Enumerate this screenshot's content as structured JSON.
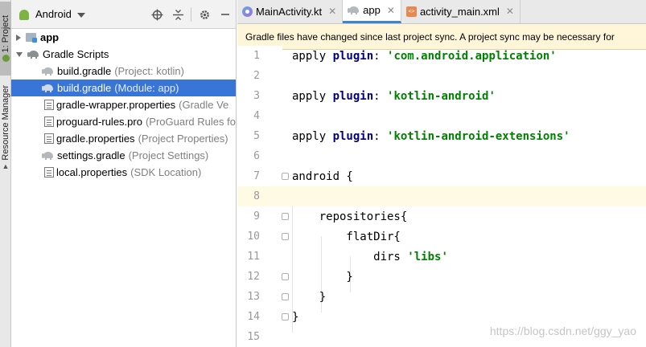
{
  "side_strip": {
    "tabs": [
      {
        "label": "1: Project"
      },
      {
        "label": "Resource Manager"
      }
    ]
  },
  "project_panel": {
    "view_selector": "Android",
    "tree": [
      {
        "label": "app",
        "hint": ""
      },
      {
        "label": "Gradle Scripts",
        "hint": ""
      },
      {
        "label": "build.gradle",
        "hint": "(Project: kotlin)"
      },
      {
        "label": "build.gradle",
        "hint": "(Module: app)"
      },
      {
        "label": "gradle-wrapper.properties",
        "hint": "(Gradle Ve"
      },
      {
        "label": "proguard-rules.pro",
        "hint": "(ProGuard Rules fo"
      },
      {
        "label": "gradle.properties",
        "hint": "(Project Properties)"
      },
      {
        "label": "settings.gradle",
        "hint": "(Project Settings)"
      },
      {
        "label": "local.properties",
        "hint": "(SDK Location)"
      }
    ]
  },
  "editor": {
    "tabs": [
      {
        "label": "MainActivity.kt",
        "active": false
      },
      {
        "label": "app",
        "active": true
      },
      {
        "label": "activity_main.xml",
        "active": false
      }
    ],
    "banner": "Gradle files have changed since last project sync. A project sync may be necessary for",
    "lines": [
      {
        "num": "1",
        "parts": [
          {
            "t": "apply ",
            "c": ""
          },
          {
            "t": "plugin",
            "c": "kw"
          },
          {
            "t": ": ",
            "c": ""
          },
          {
            "t": "'com.android.application'",
            "c": "str"
          }
        ]
      },
      {
        "num": "2",
        "parts": []
      },
      {
        "num": "3",
        "parts": [
          {
            "t": "apply ",
            "c": ""
          },
          {
            "t": "plugin",
            "c": "kw"
          },
          {
            "t": ": ",
            "c": ""
          },
          {
            "t": "'kotlin-android'",
            "c": "str"
          }
        ]
      },
      {
        "num": "4",
        "parts": []
      },
      {
        "num": "5",
        "parts": [
          {
            "t": "apply ",
            "c": ""
          },
          {
            "t": "plugin",
            "c": "kw"
          },
          {
            "t": ": ",
            "c": ""
          },
          {
            "t": "'kotlin-android-extensions'",
            "c": "str"
          }
        ]
      },
      {
        "num": "6",
        "parts": []
      },
      {
        "num": "7",
        "parts": [
          {
            "t": "android {",
            "c": ""
          }
        ]
      },
      {
        "num": "8",
        "parts": []
      },
      {
        "num": "9",
        "parts": [
          {
            "t": "    repositories{",
            "c": ""
          }
        ]
      },
      {
        "num": "10",
        "parts": [
          {
            "t": "        flatDir{",
            "c": ""
          }
        ]
      },
      {
        "num": "11",
        "parts": [
          {
            "t": "            dirs ",
            "c": ""
          },
          {
            "t": "'libs'",
            "c": "str"
          }
        ]
      },
      {
        "num": "12",
        "parts": [
          {
            "t": "        }",
            "c": ""
          }
        ]
      },
      {
        "num": "13",
        "parts": [
          {
            "t": "    }",
            "c": ""
          }
        ]
      },
      {
        "num": "14",
        "parts": [
          {
            "t": "}",
            "c": ""
          }
        ]
      },
      {
        "num": "15",
        "parts": []
      }
    ]
  },
  "watermark": "https://blog.csdn.net/ggy_yao",
  "colors": {
    "selection": "#3875d7",
    "banner_bg": "#fff6d9",
    "keyword": "#000080",
    "string": "#008000",
    "current_line": "#fffae3"
  }
}
